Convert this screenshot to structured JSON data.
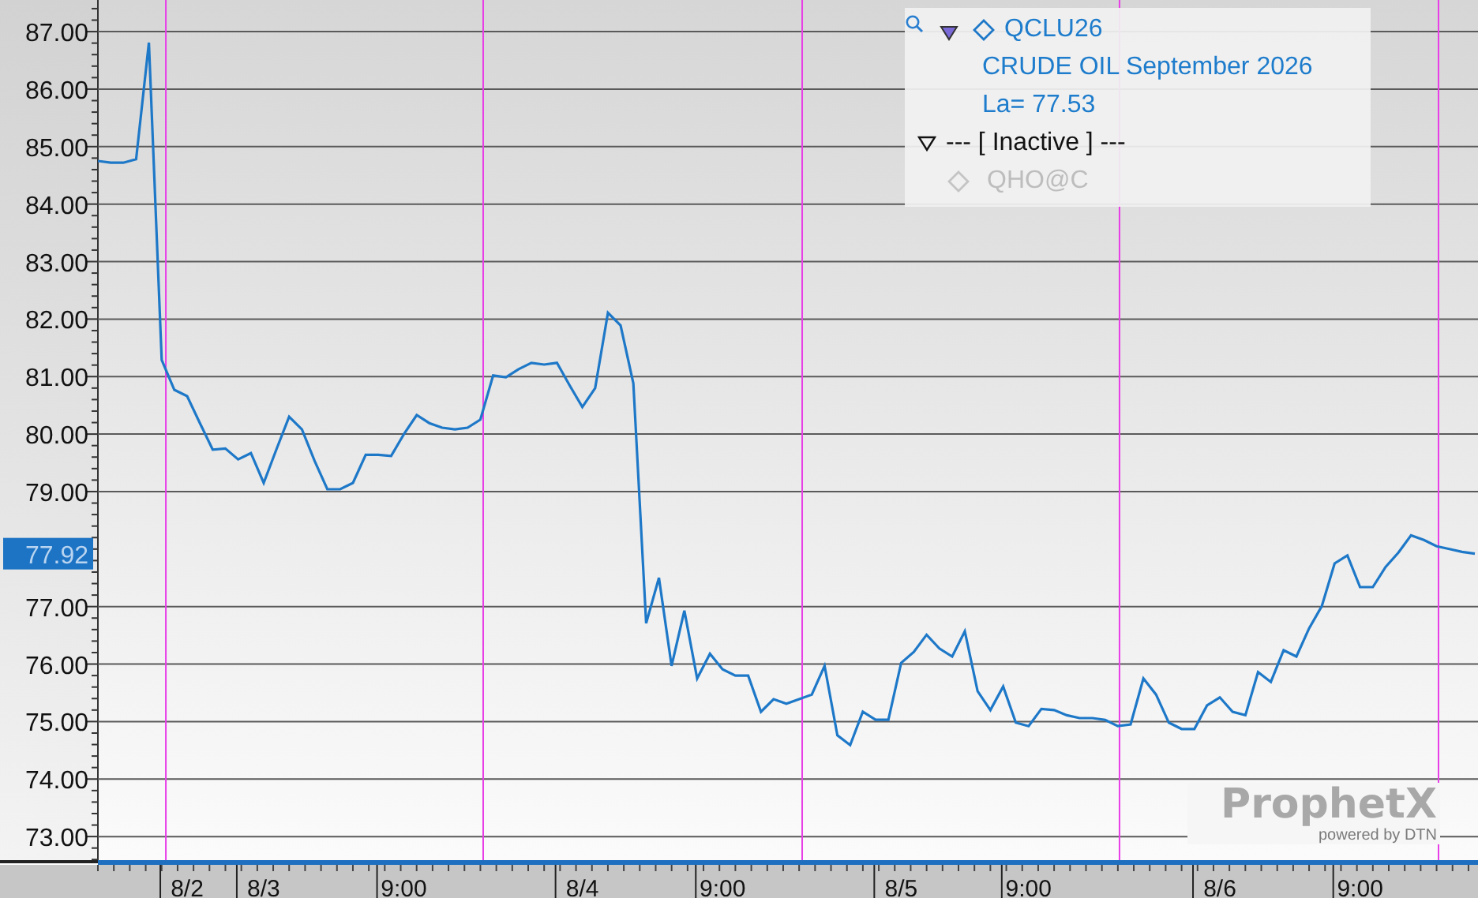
{
  "chart": {
    "current_price": "77.92",
    "chart_data": {
      "type": "line",
      "ylim": [
        72.59,
        87.55
      ],
      "grid": true,
      "categories": [
        null,
        null,
        null,
        null,
        null,
        null,
        null,
        "8/2",
        null,
        null,
        null,
        null,
        null,
        "8/3",
        null,
        null,
        null,
        null,
        null,
        null,
        null,
        null,
        null,
        null,
        "9:00",
        null,
        null,
        null,
        null,
        null,
        null,
        null,
        null,
        null,
        null,
        null,
        null,
        null,
        "8/4",
        null,
        null,
        null,
        null,
        null,
        null,
        null,
        null,
        null,
        null,
        "9:00",
        null,
        null,
        null,
        null,
        null,
        null,
        null,
        null,
        null,
        null,
        null,
        null,
        null,
        "8/5",
        null,
        null,
        null,
        null,
        null,
        null,
        null,
        null,
        null,
        "9:00",
        null,
        null,
        null,
        null,
        null,
        null,
        null,
        null,
        null,
        null,
        null,
        null,
        null,
        null,
        "8/6",
        null,
        null,
        null,
        null,
        null,
        null,
        null,
        null,
        null,
        null,
        "9:00",
        null,
        null,
        null,
        null,
        null,
        null,
        null,
        null,
        null
      ],
      "yticks": [
        {
          "value": 73,
          "label": "73.00"
        },
        {
          "value": 74,
          "label": "74.00"
        },
        {
          "value": 75,
          "label": "75.00"
        },
        {
          "value": 76,
          "label": "76.00"
        },
        {
          "value": 77,
          "label": "77.00"
        },
        {
          "value": 79,
          "label": "79.00"
        },
        {
          "value": 80,
          "label": "80.00"
        },
        {
          "value": 81,
          "label": "81.00"
        },
        {
          "value": 82,
          "label": "82.00"
        },
        {
          "value": 83,
          "label": "83.00"
        },
        {
          "value": 84,
          "label": "84.00"
        },
        {
          "value": 85,
          "label": "85.00"
        },
        {
          "value": 86,
          "label": "86.00"
        },
        {
          "value": 87,
          "label": "87.00"
        }
      ],
      "series": [
        {
          "name": "QCLU26",
          "color": "#1e78c8",
          "values": [
            84.75,
            84.72,
            84.72,
            84.78,
            86.81,
            81.29,
            80.77,
            80.66,
            80.19,
            79.73,
            79.75,
            79.56,
            79.67,
            79.15,
            79.73,
            80.3,
            80.08,
            79.53,
            79.04,
            79.04,
            79.15,
            79.64,
            79.64,
            79.62,
            80.0,
            80.33,
            80.19,
            80.11,
            80.08,
            80.11,
            80.25,
            81.02,
            80.99,
            81.13,
            81.24,
            81.21,
            81.24,
            80.85,
            80.47,
            80.8,
            82.11,
            81.89,
            80.88,
            76.71,
            77.5,
            75.97,
            76.93,
            75.75,
            76.18,
            75.91,
            75.8,
            75.8,
            75.17,
            75.39,
            75.31,
            75.39,
            75.47,
            75.97,
            74.76,
            74.59,
            75.17,
            75.03,
            75.03,
            76.02,
            76.21,
            76.51,
            76.27,
            76.13,
            76.57,
            75.53,
            75.2,
            75.61,
            74.98,
            74.92,
            75.22,
            75.2,
            75.11,
            75.06,
            75.06,
            75.03,
            74.92,
            74.95,
            75.75,
            75.47,
            74.98,
            74.87,
            74.87,
            75.28,
            75.42,
            75.17,
            75.11,
            75.86,
            75.69,
            76.24,
            76.13,
            76.62,
            77.01,
            77.75,
            77.89,
            77.34,
            77.34,
            77.69,
            77.94,
            78.24,
            78.16,
            78.05,
            78.0,
            77.95,
            77.92
          ]
        }
      ]
    }
  },
  "legend": {
    "series": {
      "description": "CRUDE OIL September 2026",
      "last": "La= 77.53"
    },
    "group": {
      "label": "--- [ Inactive ] ---",
      "items": [
        "QHO@C"
      ]
    }
  },
  "logo": {
    "name": "ProphetX",
    "tagline": "powered by DTN"
  }
}
